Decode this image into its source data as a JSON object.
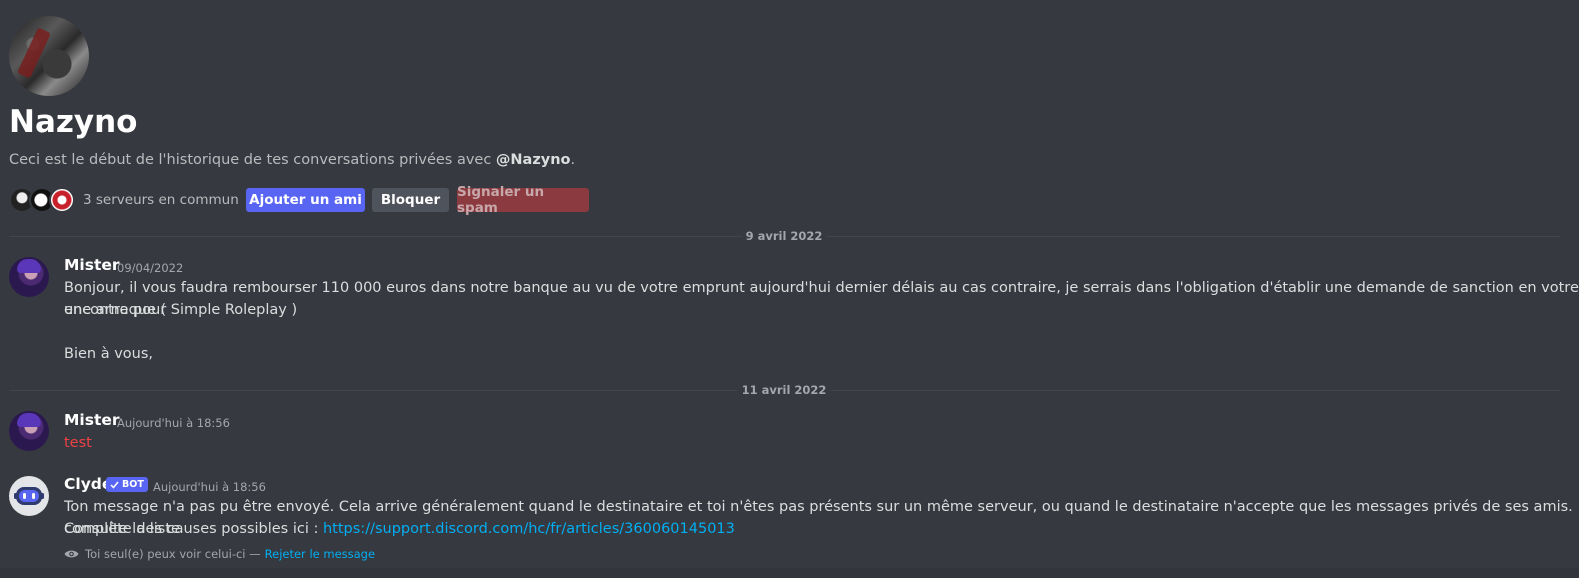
{
  "header": {
    "username": "Nazyno",
    "intro_prefix": "Ceci est le début de l'historique de tes conversations privées avec ",
    "intro_mention": "@Nazyno",
    "intro_suffix": ".",
    "mutual_servers": "3 serveurs en commun",
    "add_friend": "Ajouter un ami",
    "block": "Bloquer",
    "report_spam": "Signaler un spam"
  },
  "dividers": [
    "9 avril 2022",
    "11 avril 2022"
  ],
  "messages": [
    {
      "author": "Mister",
      "timestamp": "09/04/2022",
      "line1": "Bonjour, il vous faudra rembourser 110 000 euros dans notre banque au vu de votre emprunt aujourd'hui dernier délais au cas contraire, je serrais dans l'obligation d'établir une demande de sanction en votre encontre pour",
      "line2": "une arnaque ( Simple Roleplay  )",
      "line3": "Bien à vous,"
    },
    {
      "author": "Mister",
      "timestamp": "Aujourd'hui à 18:56",
      "text": "test"
    },
    {
      "author": "Clyde",
      "bot_tag": "BOT",
      "timestamp": "Aujourd'hui à 18:56",
      "line1": "Ton message n'a pas pu être envoyé. Cela arrive généralement quand le destinataire et toi n'êtes pas présents sur un même serveur, ou quand le destinataire n'accepte que les messages privés de ses amis. Consulte la liste",
      "line2_prefix": "complète des causes possibles ici : ",
      "link": "https://support.discord.com/hc/fr/articles/360060145013",
      "ephemeral_note": "Toi seul(e) peux voir celui-ci —",
      "dismiss": "Rejeter le message"
    }
  ],
  "colors": {
    "background": "#36393f",
    "blurple": "#5865f2",
    "danger": "#ed4245",
    "link": "#00aff4"
  },
  "icons": [
    "eye-icon",
    "bot-check-icon",
    "clyde-robot-icon"
  ]
}
